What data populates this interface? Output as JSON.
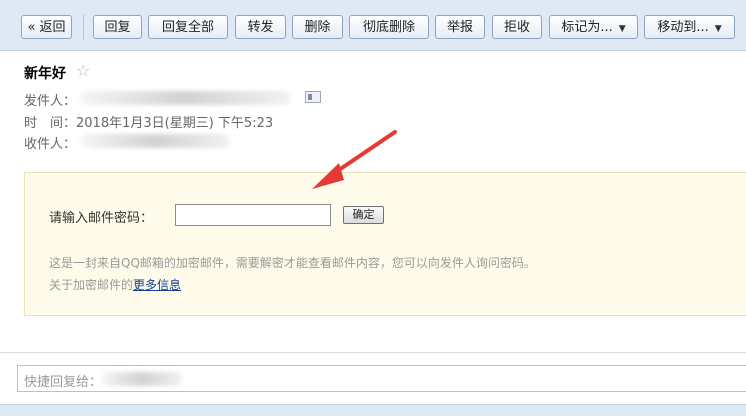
{
  "toolbar": {
    "back": "« 返回",
    "reply": "回复",
    "reply_all": "回复全部",
    "forward": "转发",
    "delete": "删除",
    "delete_forever": "彻底删除",
    "report": "举报",
    "reject": "拒收",
    "mark_as": "标记为...",
    "move_to": "移动到..."
  },
  "mail": {
    "subject": "新年好",
    "sender_label": "发件人：",
    "time_label": "时　间：",
    "time_value": "2018年1月3日(星期三) 下午5:23",
    "recipient_label": "收件人："
  },
  "encrypted": {
    "password_label": "请输入邮件密码：",
    "confirm_button": "确定",
    "hint": "这是一封来自QQ邮箱的加密邮件，需要解密才能查看邮件内容，您可以向发件人询问密码。",
    "more_prefix": "关于加密邮件的",
    "more_link": "更多信息"
  },
  "quick_reply": {
    "placeholder": "快捷回复给："
  },
  "colors": {
    "toolbar_bg": "#dfe9f5",
    "notice_bg": "#fefbea",
    "annotation_arrow": "#e53935",
    "link": "#0d3e90"
  }
}
